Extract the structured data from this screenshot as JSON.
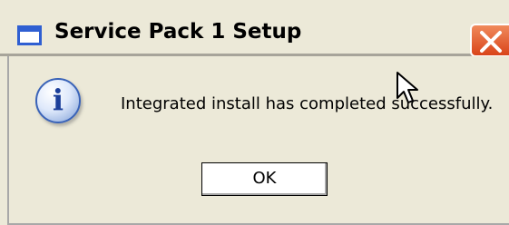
{
  "window": {
    "title": "Service Pack 1 Setup",
    "close_icon": "close-icon",
    "app_icon": "window-icon"
  },
  "dialog": {
    "icon": "info-icon",
    "icon_glyph": "i",
    "message": "Integrated install has completed successfully.",
    "ok_label": "OK"
  },
  "colors": {
    "dialog_background": "#ece9d8",
    "close_button": "#d9441a",
    "title_icon": "#2f5fd2"
  }
}
